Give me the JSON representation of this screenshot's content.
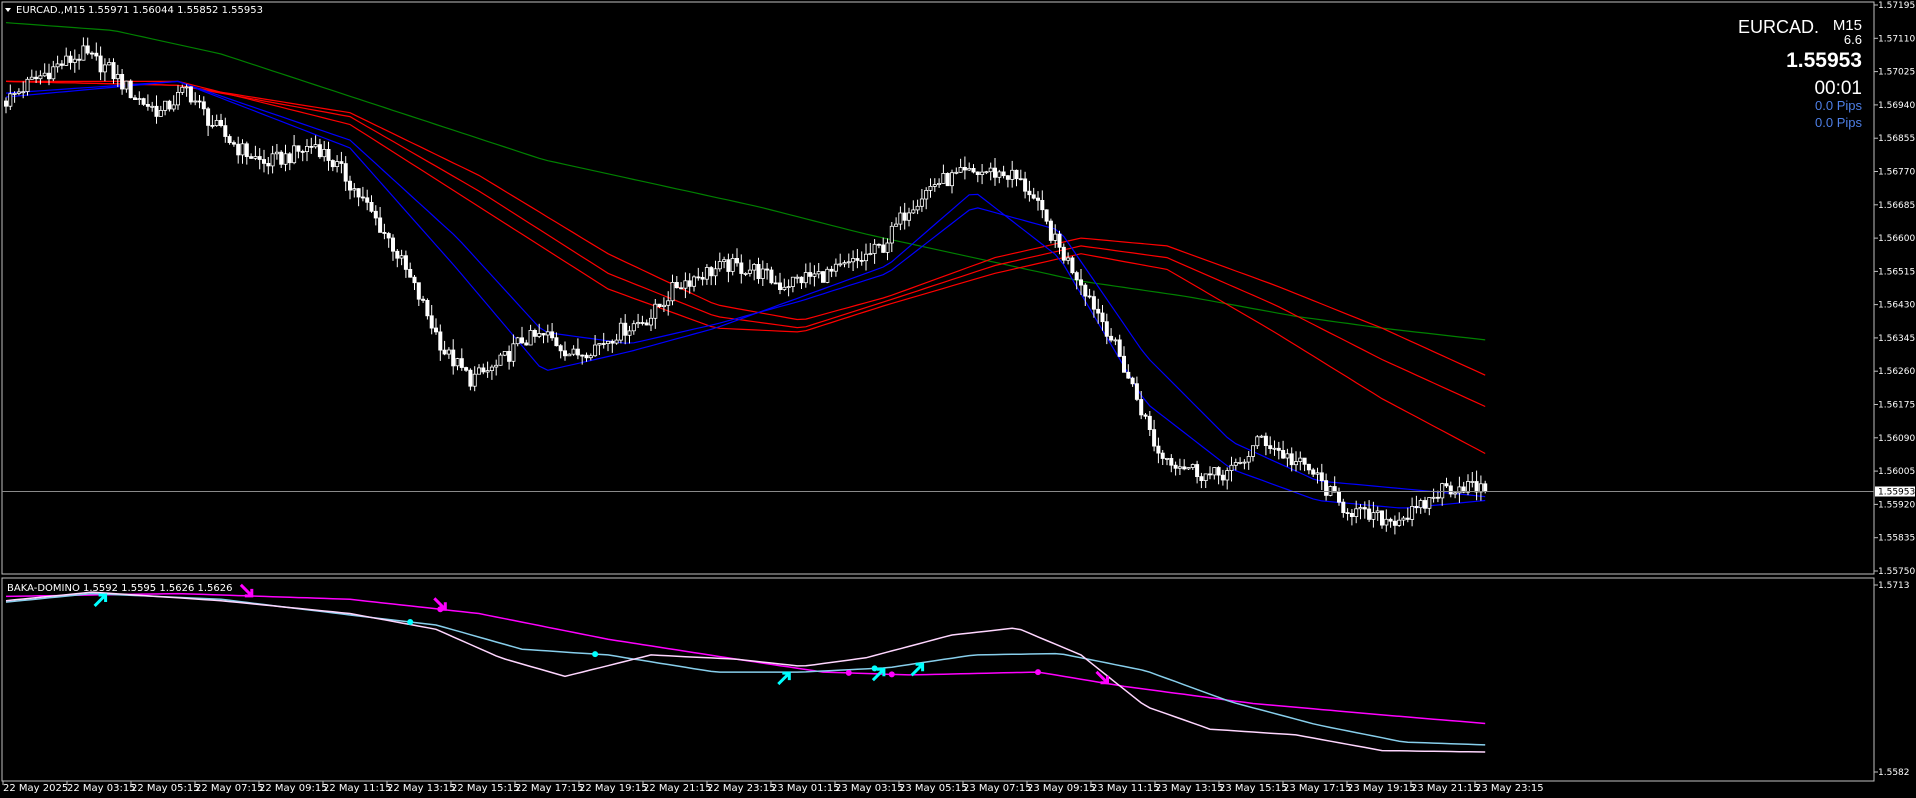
{
  "window": {
    "symbol_header": "EURCAD.,M15",
    "ohlc": "1.55971 1.56044 1.55852 1.55953",
    "menu_icon": "triangle-down-icon"
  },
  "info_panel": {
    "symbol": "EURCAD.",
    "timeframe": "M15",
    "spread": "6.6",
    "price": "1.55953",
    "timer": "00:01",
    "pips_1": "0.0 Pips",
    "pips_2": "0.0 Pips"
  },
  "indicator": {
    "header": "BAKA-DOMINO 1.5592 1.5595 1.5626 1.5626",
    "scale_top": "1.5713",
    "scale_bottom": "1.5582"
  },
  "colors": {
    "background": "#000000",
    "candle": "#ffffff",
    "ma_fast": "#0000ff",
    "ma_slow": "#ff0000",
    "ma_long": "#008000",
    "osc_slow": "#ff00ff",
    "osc_mid": "#87ceeb",
    "osc_fast": "#ffd6ff",
    "arrow_up": "#00ffff",
    "arrow_down": "#ff00ff",
    "price_line": "#808080",
    "pips_text": "#4e7fe6"
  },
  "chart_data": [
    {
      "type": "candlestick",
      "title": "EURCAD.,M15",
      "current_price": 1.55953,
      "y_ticks": [
        "1.57195",
        "1.57110",
        "1.57025",
        "1.56940",
        "1.56855",
        "1.56770",
        "1.56685",
        "1.56600",
        "1.56515",
        "1.56430",
        "1.56345",
        "1.56260",
        "1.56175",
        "1.56090",
        "1.56005",
        "1.55920",
        "1.55835",
        "1.55750"
      ],
      "ylim": [
        1.5575,
        1.57195
      ],
      "x_labels": [
        "22 May 2025",
        "22 May 03:15",
        "22 May 05:15",
        "22 May 07:15",
        "22 May 09:15",
        "22 May 11:15",
        "22 May 13:15",
        "22 May 15:15",
        "22 May 17:15",
        "22 May 19:15",
        "22 May 21:15",
        "22 May 23:15",
        "23 May 01:15",
        "23 May 03:15",
        "23 May 05:15",
        "23 May 07:15",
        "23 May 09:15",
        "23 May 11:15",
        "23 May 13:15",
        "23 May 15:15",
        "23 May 17:15",
        "23 May 19:15",
        "23 May 21:15",
        "23 May 23:15"
      ],
      "price_path": [
        [
          0,
          1.5695
        ],
        [
          6,
          1.57
        ],
        [
          12,
          1.5704
        ],
        [
          18,
          1.5707
        ],
        [
          24,
          1.5703
        ],
        [
          30,
          1.5696
        ],
        [
          36,
          1.5692
        ],
        [
          42,
          1.5698
        ],
        [
          48,
          1.5689
        ],
        [
          54,
          1.5683
        ],
        [
          60,
          1.5679
        ],
        [
          66,
          1.5681
        ],
        [
          72,
          1.5684
        ],
        [
          78,
          1.5677
        ],
        [
          84,
          1.5668
        ],
        [
          90,
          1.5658
        ],
        [
          96,
          1.5645
        ],
        [
          102,
          1.5631
        ],
        [
          108,
          1.5624
        ],
        [
          114,
          1.5627
        ],
        [
          120,
          1.5634
        ],
        [
          126,
          1.5635
        ],
        [
          132,
          1.563
        ],
        [
          138,
          1.5633
        ],
        [
          144,
          1.5637
        ],
        [
          150,
          1.564
        ],
        [
          156,
          1.5648
        ],
        [
          162,
          1.5651
        ],
        [
          168,
          1.5653
        ],
        [
          174,
          1.5652
        ],
        [
          180,
          1.5648
        ],
        [
          186,
          1.565
        ],
        [
          192,
          1.5651
        ],
        [
          198,
          1.5654
        ],
        [
          204,
          1.5658
        ],
        [
          210,
          1.5668
        ],
        [
          216,
          1.5674
        ],
        [
          222,
          1.5676
        ],
        [
          228,
          1.5677
        ],
        [
          234,
          1.5676
        ],
        [
          238,
          1.5672
        ],
        [
          244,
          1.5659
        ],
        [
          250,
          1.5649
        ],
        [
          256,
          1.5637
        ],
        [
          262,
          1.5622
        ],
        [
          268,
          1.5605
        ],
        [
          274,
          1.5602
        ],
        [
          280,
          1.5599
        ],
        [
          286,
          1.5601
        ],
        [
          292,
          1.5609
        ],
        [
          298,
          1.5604
        ],
        [
          304,
          1.56
        ],
        [
          310,
          1.5592
        ],
        [
          316,
          1.5589
        ],
        [
          322,
          1.5588
        ],
        [
          328,
          1.559
        ],
        [
          334,
          1.5596
        ],
        [
          340,
          1.5597
        ],
        [
          344,
          1.5595
        ]
      ],
      "moving_averages": [
        {
          "color": "ma_long",
          "values": [
            [
              0,
              1.5715
            ],
            [
              25,
              1.5713
            ],
            [
              50,
              1.5707
            ],
            [
              75,
              1.5698
            ],
            [
              100,
              1.5689
            ],
            [
              125,
              1.568
            ],
            [
              150,
              1.5674
            ],
            [
              175,
              1.5668
            ],
            [
              200,
              1.5661
            ],
            [
              225,
              1.5655
            ],
            [
              250,
              1.5649
            ],
            [
              275,
              1.5645
            ],
            [
              300,
              1.564
            ],
            [
              320,
              1.5637
            ],
            [
              344,
              1.5634
            ]
          ]
        },
        {
          "color": "ma_slow",
          "values": [
            [
              0,
              1.57
            ],
            [
              40,
              1.5699
            ],
            [
              80,
              1.5692
            ],
            [
              110,
              1.5676
            ],
            [
              140,
              1.5656
            ],
            [
              165,
              1.5643
            ],
            [
              185,
              1.5639
            ],
            [
              205,
              1.5645
            ],
            [
              230,
              1.5655
            ],
            [
              250,
              1.566
            ],
            [
              270,
              1.5658
            ],
            [
              295,
              1.5648
            ],
            [
              320,
              1.5637
            ],
            [
              344,
              1.5625
            ]
          ]
        },
        {
          "color": "ma_slow",
          "values": [
            [
              0,
              1.57
            ],
            [
              40,
              1.5699
            ],
            [
              80,
              1.5691
            ],
            [
              110,
              1.5672
            ],
            [
              140,
              1.5651
            ],
            [
              165,
              1.564
            ],
            [
              185,
              1.5637
            ],
            [
              205,
              1.5644
            ],
            [
              230,
              1.5653
            ],
            [
              250,
              1.5658
            ],
            [
              270,
              1.5655
            ],
            [
              295,
              1.5643
            ],
            [
              320,
              1.5629
            ],
            [
              344,
              1.5617
            ]
          ]
        },
        {
          "color": "ma_slow",
          "values": [
            [
              0,
              1.57
            ],
            [
              40,
              1.57
            ],
            [
              80,
              1.5689
            ],
            [
              110,
              1.5668
            ],
            [
              140,
              1.5647
            ],
            [
              165,
              1.5637
            ],
            [
              185,
              1.5636
            ],
            [
              205,
              1.5643
            ],
            [
              230,
              1.5651
            ],
            [
              250,
              1.5656
            ],
            [
              270,
              1.5652
            ],
            [
              295,
              1.5636
            ],
            [
              320,
              1.5619
            ],
            [
              344,
              1.5605
            ]
          ]
        },
        {
          "color": "ma_fast",
          "values": [
            [
              0,
              1.5697
            ],
            [
              40,
              1.57
            ],
            [
              80,
              1.5685
            ],
            [
              105,
              1.566
            ],
            [
              125,
              1.5636
            ],
            [
              145,
              1.5633
            ],
            [
              165,
              1.5638
            ],
            [
              185,
              1.5644
            ],
            [
              205,
              1.5651
            ],
            [
              225,
              1.5668
            ],
            [
              245,
              1.5662
            ],
            [
              265,
              1.563
            ],
            [
              285,
              1.5608
            ],
            [
              305,
              1.5598
            ],
            [
              325,
              1.5596
            ],
            [
              344,
              1.5594
            ]
          ]
        },
        {
          "color": "ma_fast",
          "values": [
            [
              0,
              1.5696
            ],
            [
              40,
              1.57
            ],
            [
              80,
              1.5683
            ],
            [
              105,
              1.5652
            ],
            [
              125,
              1.5626
            ],
            [
              145,
              1.5631
            ],
            [
              165,
              1.5637
            ],
            [
              185,
              1.5645
            ],
            [
              205,
              1.5653
            ],
            [
              225,
              1.5672
            ],
            [
              245,
              1.5655
            ],
            [
              265,
              1.5618
            ],
            [
              285,
              1.5601
            ],
            [
              305,
              1.5593
            ],
            [
              325,
              1.5591
            ],
            [
              344,
              1.5593
            ]
          ]
        }
      ]
    },
    {
      "type": "line",
      "title": "BAKA-DOMINO 1.5592 1.5595 1.5626 1.5626",
      "ylim": [
        1.5582,
        1.5713
      ],
      "y_ticks": [
        "1.5713",
        "1.5582"
      ],
      "series": [
        {
          "color": "osc_slow",
          "values": [
            [
              0,
              1.5705
            ],
            [
              40,
              1.5707
            ],
            [
              80,
              1.5703
            ],
            [
              110,
              1.5693
            ],
            [
              140,
              1.5675
            ],
            [
              170,
              1.5661
            ],
            [
              190,
              1.5652
            ],
            [
              210,
              1.565
            ],
            [
              240,
              1.5652
            ],
            [
              260,
              1.5642
            ],
            [
              290,
              1.563
            ],
            [
              320,
              1.5622
            ],
            [
              344,
              1.5616
            ]
          ]
        },
        {
          "color": "osc_mid",
          "values": [
            [
              0,
              1.5701
            ],
            [
              20,
              1.5707
            ],
            [
              50,
              1.5703
            ],
            [
              80,
              1.5692
            ],
            [
              100,
              1.5685
            ],
            [
              120,
              1.5668
            ],
            [
              140,
              1.5664
            ],
            [
              165,
              1.5652
            ],
            [
              185,
              1.5652
            ],
            [
              205,
              1.5655
            ],
            [
              225,
              1.5664
            ],
            [
              245,
              1.5665
            ],
            [
              265,
              1.5653
            ],
            [
              285,
              1.5631
            ],
            [
              305,
              1.5615
            ],
            [
              325,
              1.5603
            ],
            [
              344,
              1.5601
            ]
          ]
        },
        {
          "color": "osc_fast",
          "values": [
            [
              0,
              1.5702
            ],
            [
              20,
              1.5708
            ],
            [
              50,
              1.5702
            ],
            [
              80,
              1.5693
            ],
            [
              100,
              1.5682
            ],
            [
              115,
              1.5662
            ],
            [
              130,
              1.5649
            ],
            [
              150,
              1.5664
            ],
            [
              170,
              1.5661
            ],
            [
              185,
              1.5656
            ],
            [
              200,
              1.5662
            ],
            [
              220,
              1.5678
            ],
            [
              235,
              1.5683
            ],
            [
              250,
              1.5664
            ],
            [
              265,
              1.5628
            ],
            [
              280,
              1.5612
            ],
            [
              300,
              1.5608
            ],
            [
              320,
              1.5597
            ],
            [
              344,
              1.5596
            ]
          ]
        }
      ],
      "up_arrows": [
        22,
        181,
        203,
        212
      ],
      "down_arrows": [
        56,
        101,
        255
      ],
      "dots_cyan": [
        94,
        137,
        202
      ],
      "dots_magenta": [
        101,
        196,
        206,
        240
      ]
    }
  ]
}
